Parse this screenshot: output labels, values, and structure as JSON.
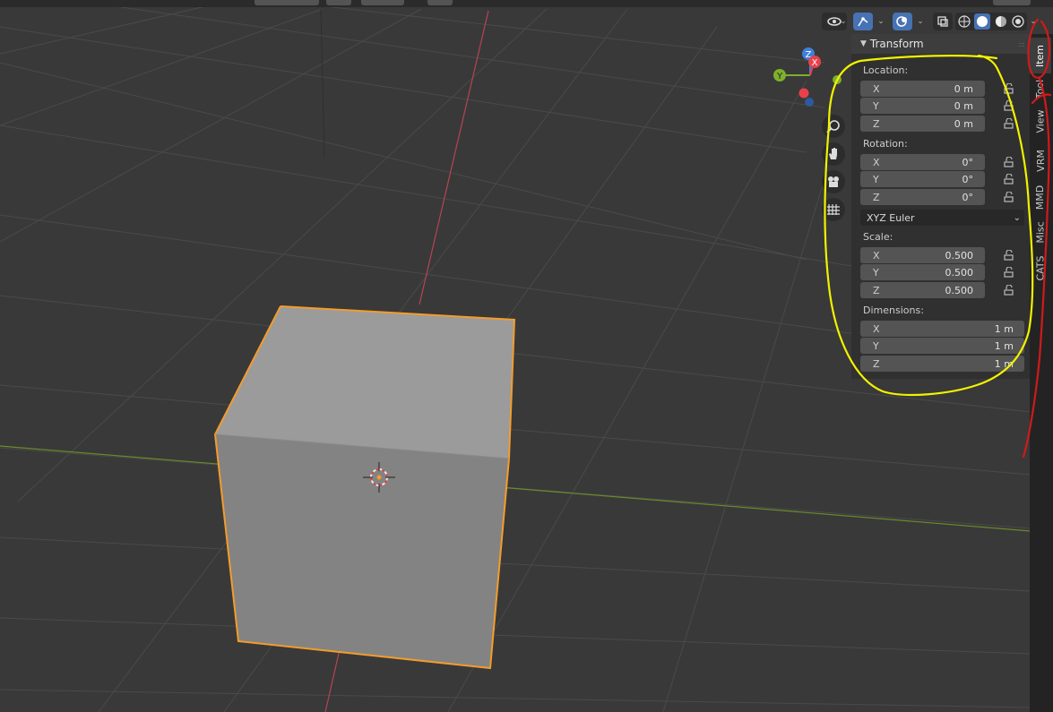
{
  "n_panel": {
    "title": "Transform",
    "location": {
      "label": "Location:",
      "fields": [
        {
          "axis": "X",
          "value": "0 m"
        },
        {
          "axis": "Y",
          "value": "0 m"
        },
        {
          "axis": "Z",
          "value": "0 m"
        }
      ]
    },
    "rotation": {
      "label": "Rotation:",
      "fields": [
        {
          "axis": "X",
          "value": "0°"
        },
        {
          "axis": "Y",
          "value": "0°"
        },
        {
          "axis": "Z",
          "value": "0°"
        }
      ],
      "mode": "XYZ Euler"
    },
    "scale": {
      "label": "Scale:",
      "fields": [
        {
          "axis": "X",
          "value": "0.500"
        },
        {
          "axis": "Y",
          "value": "0.500"
        },
        {
          "axis": "Z",
          "value": "0.500"
        }
      ]
    },
    "dimensions": {
      "label": "Dimensions:",
      "fields": [
        {
          "axis": "X",
          "value": "1 m"
        },
        {
          "axis": "Y",
          "value": "1 m"
        },
        {
          "axis": "Z",
          "value": "1 m"
        }
      ]
    }
  },
  "tabs": [
    {
      "label": "Item",
      "active": true
    },
    {
      "label": "Tool",
      "active": false
    },
    {
      "label": "View",
      "active": false
    },
    {
      "label": "VRM",
      "active": false
    },
    {
      "label": "MMD",
      "active": false
    },
    {
      "label": "Misc",
      "active": false
    },
    {
      "label": "CATS",
      "active": false
    }
  ],
  "gizmo": {
    "x_label": "X",
    "y_label": "Y",
    "z_label": "Z"
  },
  "colors": {
    "viewport_bg": "#393939",
    "panel_bg": "#303030",
    "field_bg": "#545454",
    "accent_blue": "#4772b3",
    "selection_orange": "#f39c2c",
    "annotation_yellow": "#f2f200",
    "annotation_red": "#d01a1a",
    "axis_x": "#e8414b",
    "axis_y": "#7fb02c",
    "axis_z": "#3d7fdc"
  }
}
